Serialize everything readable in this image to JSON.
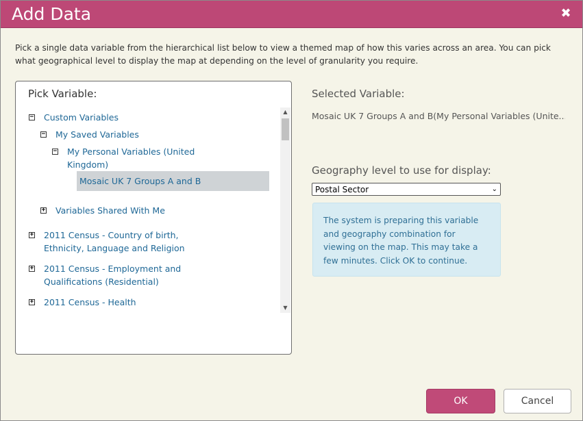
{
  "dialog": {
    "title": "Add Data",
    "close_glyph": "✖",
    "intro": "Pick a single data variable from the hierarchical list below to view a themed map of how this varies across an area. You can pick what geographical level to display the map at depending on the level of granularity you require."
  },
  "tree": {
    "heading": "Pick Variable:",
    "nodes": [
      {
        "label": "Custom Variables",
        "toggle": "minus"
      },
      {
        "label": "My Saved Variables",
        "toggle": "minus"
      },
      {
        "label": "My Personal Variables (United Kingdom)",
        "toggle": "minus"
      },
      {
        "label": "Mosaic UK 7 Groups A and B",
        "selected": true
      },
      {
        "label": "Variables Shared With Me",
        "toggle": "plus"
      },
      {
        "label": "2011 Census - Country of birth, Ethnicity, Language and Religion",
        "toggle": "plus"
      },
      {
        "label": "2011 Census - Employment and Qualifications (Residential)",
        "toggle": "plus"
      },
      {
        "label": "2011 Census - Health",
        "toggle": "plus"
      }
    ],
    "scroll_up_glyph": "▲",
    "scroll_down_glyph": "▼"
  },
  "selected": {
    "label": "Selected Variable:",
    "value": "Mosaic UK 7 Groups A and B(My Personal Variables (Unite..."
  },
  "geography": {
    "label": "Geography level to use for display:",
    "selected_option": "Postal Sector",
    "chevron": "⌄"
  },
  "info": {
    "message": "The system is preparing this variable and geography combination for viewing on the map. This may take a few minutes. Click OK to continue."
  },
  "buttons": {
    "ok": "OK",
    "cancel": "Cancel"
  },
  "colors": {
    "titlebar": "#bd4876",
    "ok_button": "#c04a78",
    "link": "#1e6796",
    "info_bg": "#d8ecf3"
  }
}
